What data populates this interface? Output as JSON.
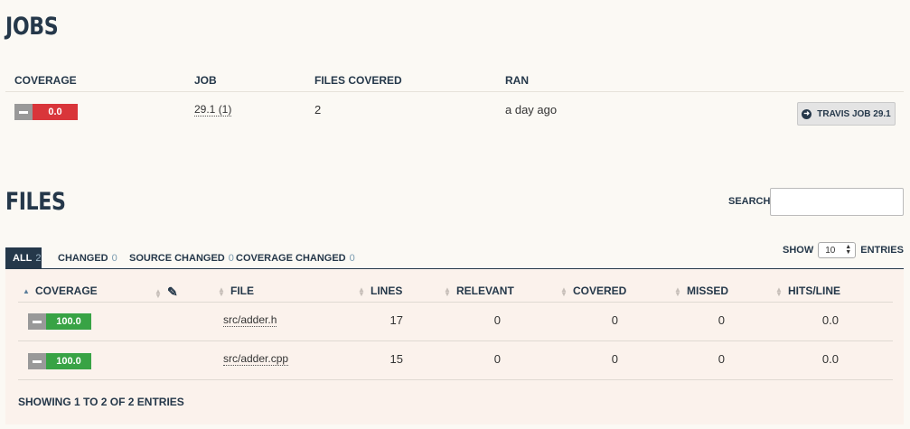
{
  "jobs": {
    "title": "JOBS",
    "headers": {
      "coverage": "COVERAGE",
      "job": "JOB",
      "files_covered": "FILES COVERED",
      "ran": "RAN"
    },
    "row": {
      "coverage": "0.0",
      "job": "29.1 (1)",
      "files_covered": "2",
      "ran": "a day ago",
      "button": "TRAVIS JOB 29.1"
    }
  },
  "files": {
    "title": "FILES",
    "search_label": "SEARCH:",
    "search_value": "",
    "show_label": "SHOW",
    "show_value": "10",
    "entries_label": "ENTRIES",
    "tabs": [
      {
        "label": "ALL",
        "count": "2"
      },
      {
        "label": "CHANGED",
        "count": "0"
      },
      {
        "label": "SOURCE CHANGED",
        "count": "0"
      },
      {
        "label": "COVERAGE CHANGED",
        "count": "0"
      }
    ],
    "columns": {
      "coverage": "COVERAGE",
      "file": "FILE",
      "lines": "LINES",
      "relevant": "RELEVANT",
      "covered": "COVERED",
      "missed": "MISSED",
      "hits_line": "HITS/LINE"
    },
    "rows": [
      {
        "coverage": "100.0",
        "file": "src/adder.h",
        "lines": "17",
        "relevant": "0",
        "covered": "0",
        "missed": "0",
        "hits_line": "0.0"
      },
      {
        "coverage": "100.0",
        "file": "src/adder.cpp",
        "lines": "15",
        "relevant": "0",
        "covered": "0",
        "missed": "0",
        "hits_line": "0.0"
      }
    ],
    "footer": "SHOWING 1 TO 2 OF 2 ENTRIES"
  },
  "colors": {
    "heading": "#25384a",
    "red": "#d9353a",
    "green": "#38a345"
  },
  "icons": [
    "minus-icon",
    "circle-arrow-right-icon",
    "sort-icon",
    "pencil-icon",
    "chevron-updown-icon"
  ]
}
